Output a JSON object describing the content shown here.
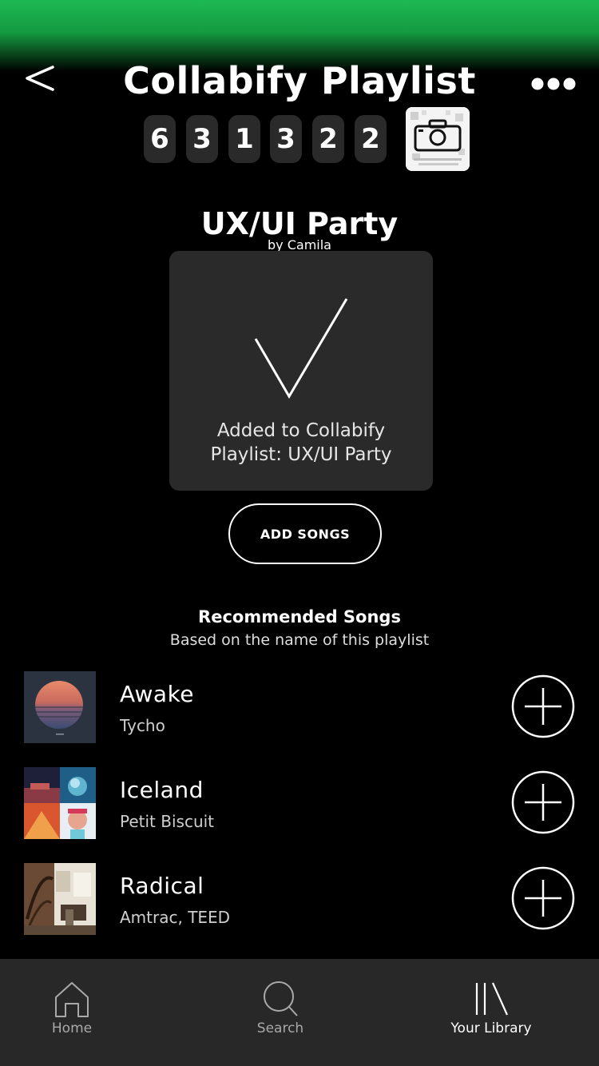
{
  "header": {
    "title": "Collabify Playlist",
    "code_digits": [
      "6",
      "3",
      "1",
      "3",
      "2",
      "2"
    ],
    "back_icon": "chevron-left-icon",
    "more_icon": "more-horizontal-icon",
    "camera_icon": "camera-icon"
  },
  "playlist": {
    "name": "UX/UI Party",
    "owner": "by Camila"
  },
  "toast": {
    "icon": "checkmark-icon",
    "message": "Added to Collabify Playlist: UX/UI Party"
  },
  "add_songs_label": "ADD SONGS",
  "recommended": {
    "title": "Recommended Songs",
    "subtitle": "Based on the name of this playlist",
    "songs": [
      {
        "title": "Awake",
        "artist": "Tycho"
      },
      {
        "title": "Iceland",
        "artist": "Petit Biscuit"
      },
      {
        "title": "Radical",
        "artist": "Amtrac, TEED"
      }
    ]
  },
  "nav": {
    "items": [
      {
        "label": "Home",
        "icon": "home-icon"
      },
      {
        "label": "Search",
        "icon": "search-icon"
      },
      {
        "label": "Your Library",
        "icon": "library-icon",
        "active": true
      }
    ]
  },
  "colors": {
    "brand_green": "#1db954",
    "background": "#000000",
    "card": "#2a2a2a",
    "nav_bg": "#282828"
  }
}
